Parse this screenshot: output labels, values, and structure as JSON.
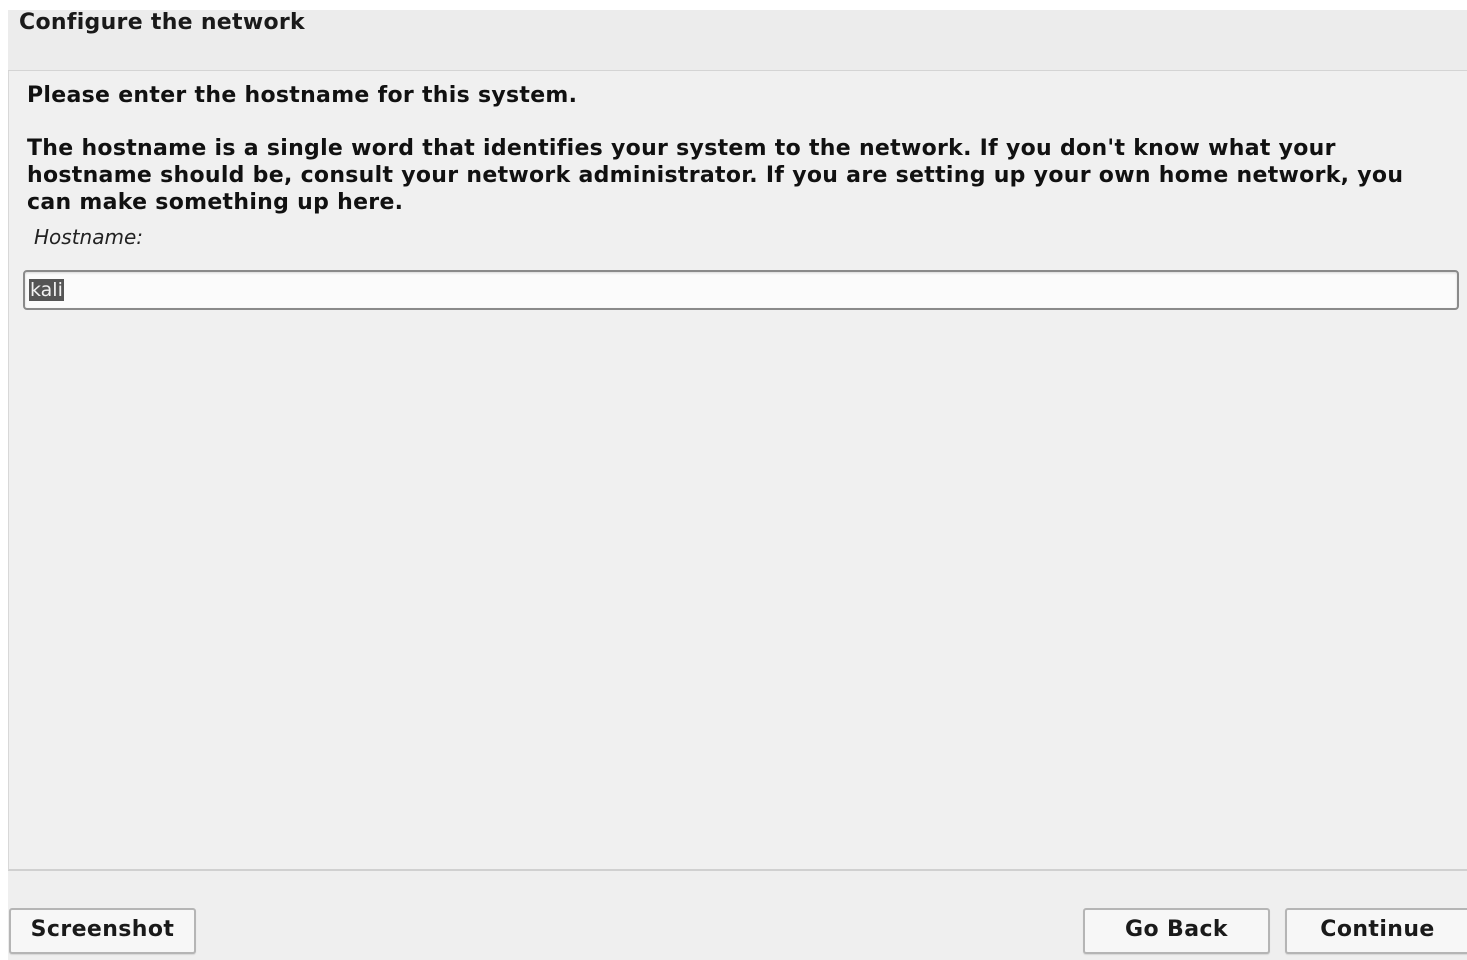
{
  "window": {
    "title": "Configure the network"
  },
  "main": {
    "question": "Please enter the hostname for this system.",
    "description": "The hostname is a single word that identifies your system to the network. If you don't know what your hostname should be, consult your network administrator. If you are setting up your own home network, you can make something up here.",
    "field_label": "Hostname:",
    "hostname_value": "kali"
  },
  "footer": {
    "screenshot_label": "Screenshot",
    "go_back_label": "Go Back",
    "continue_label": "Continue"
  },
  "colors": {
    "background": "#efefef",
    "selection": "#555555"
  }
}
